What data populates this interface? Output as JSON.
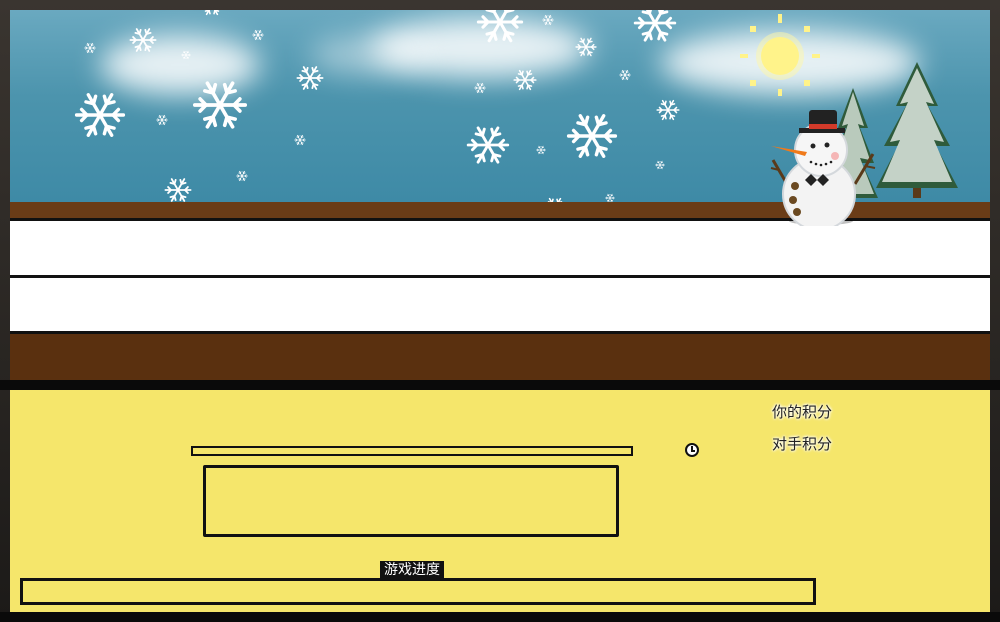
{
  "scoreboard": {
    "your_score_label": "你的积分",
    "opponent_score_label": "对手积分"
  },
  "progress": {
    "label": "游戏进度",
    "value_fraction": 0
  },
  "icons": {
    "timer": "clock-icon",
    "player": "snowman-icon",
    "sun": "sun-icon",
    "trees": "pine-tree-icon",
    "snow": "snowflake-icon"
  },
  "colors": {
    "sky": "#4c94ad",
    "panel": "#f5e66b",
    "dirt": "#5a300f"
  }
}
